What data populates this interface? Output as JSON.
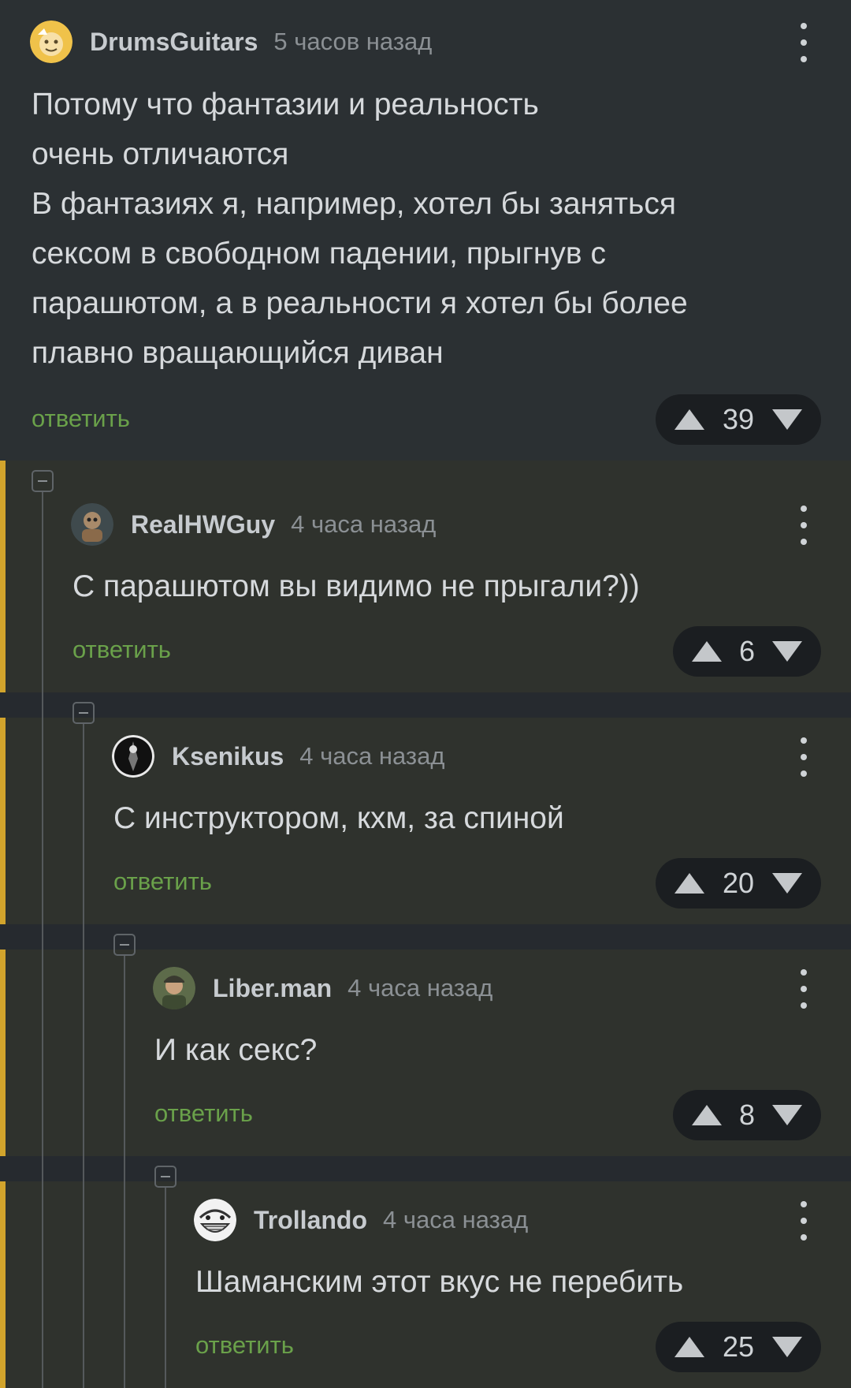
{
  "comments": [
    {
      "username": "DrumsGuitars",
      "time": "5 часов назад",
      "text": "Потому что фантазии и реальность\nочень отличаются\nВ фантазиях я, например, хотел бы заняться\nсексом в свободном падении, прыгнув с\nпарашютом, а в реальности я хотел бы более\nплавно вращающийся диван",
      "reply_label": "ответить",
      "score": "39"
    },
    {
      "username": "RealHWGuy",
      "time": "4 часа назад",
      "text": "С парашютом вы видимо не прыгали?))",
      "reply_label": "ответить",
      "score": "6"
    },
    {
      "username": "Ksenikus",
      "time": "4 часа назад",
      "text": "С инструктором, кхм, за спиной",
      "reply_label": "ответить",
      "score": "20"
    },
    {
      "username": "Liber.man",
      "time": "4 часа назад",
      "text": "И как секс?",
      "reply_label": "ответить",
      "score": "8"
    },
    {
      "username": "Trollando",
      "time": "4 часа назад",
      "text": "Шаманским этот вкус не перебить",
      "reply_label": "ответить",
      "score": "25"
    }
  ],
  "icons": {
    "upvote": "upvote-arrow-icon",
    "downvote": "downvote-arrow-icon",
    "menu": "more-vertical-icon",
    "collapse": "collapse-minus-icon"
  },
  "colors": {
    "background": "#262a2f",
    "root_comment_bg": "#2b3033",
    "reply_bg": "#2f322d",
    "accent_bar": "#d2a42c",
    "reply_link": "#6aa14a",
    "vote_pill": "#1b1e21"
  }
}
